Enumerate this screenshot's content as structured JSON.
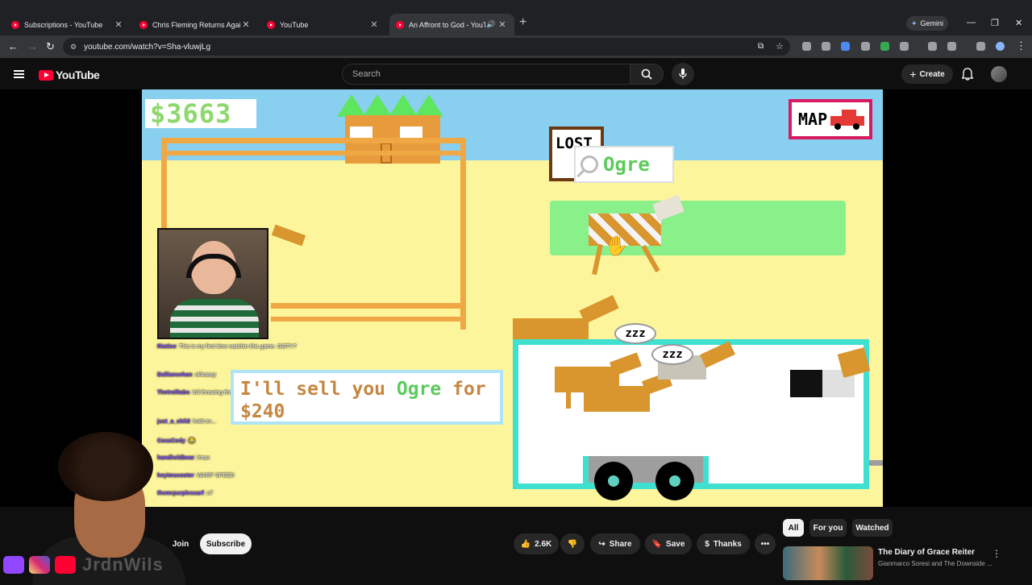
{
  "browser": {
    "tabs": [
      {
        "title": "Subscriptions - YouTube"
      },
      {
        "title": "Chris Fleming Returns Again - Y"
      },
      {
        "title": "YouTube"
      },
      {
        "title": "An Affront to God - YouTub"
      }
    ],
    "new_tab": "+",
    "gemini_label": "Gemini",
    "url": "youtube.com/watch?v=Sha-vluwjLg"
  },
  "youtube": {
    "logo_text": "YouTube",
    "search_placeholder": "Search",
    "create_label": "Create"
  },
  "game": {
    "money": "$3663",
    "map_label": "MAP",
    "lost_label": "LOST",
    "horse_name_tooltip": "Ogre",
    "dialog_prefix": "I'll sell you ",
    "dialog_name": "Ogre",
    "dialog_suffix": " for",
    "dialog_price": "$240",
    "zzz1": "zzz",
    "zzz2": "zzz"
  },
  "chat": [
    {
      "user": "Riotice",
      "text": "This is my first time watchin this game. GOTY?"
    },
    {
      "user": "Dalliancehan",
      "text": "okkaaay"
    },
    {
      "user": "Thetrolltabs",
      "text": "loll throwing them away literally"
    },
    {
      "user": "just_a_child",
      "text": "hold on..."
    },
    {
      "user": "CocaCody",
      "text": "😂"
    },
    {
      "user": "handheldbear",
      "text": "lmao"
    },
    {
      "user": "heyimscooter",
      "text": "WARP SPEED"
    },
    {
      "user": "themrpurplescarf",
      "text": "o7"
    }
  ],
  "streamer_handle": "JrdnWils",
  "actions": {
    "join": "Join",
    "subscribe": "Subscribe",
    "likes": "2.6K",
    "share": "Share",
    "save": "Save",
    "thanks": "Thanks"
  },
  "filters": [
    "All",
    "For you",
    "Watched"
  ],
  "recommendation": {
    "title": "The Diary of Grace Reiter",
    "channel": "Gianmarco Soresi and The Downside ..."
  },
  "colors": {
    "yt_red": "#ff0033",
    "money_green": "#8dd86b",
    "trailer_teal": "#3fe0d0",
    "horse_tan": "#d9952e"
  }
}
